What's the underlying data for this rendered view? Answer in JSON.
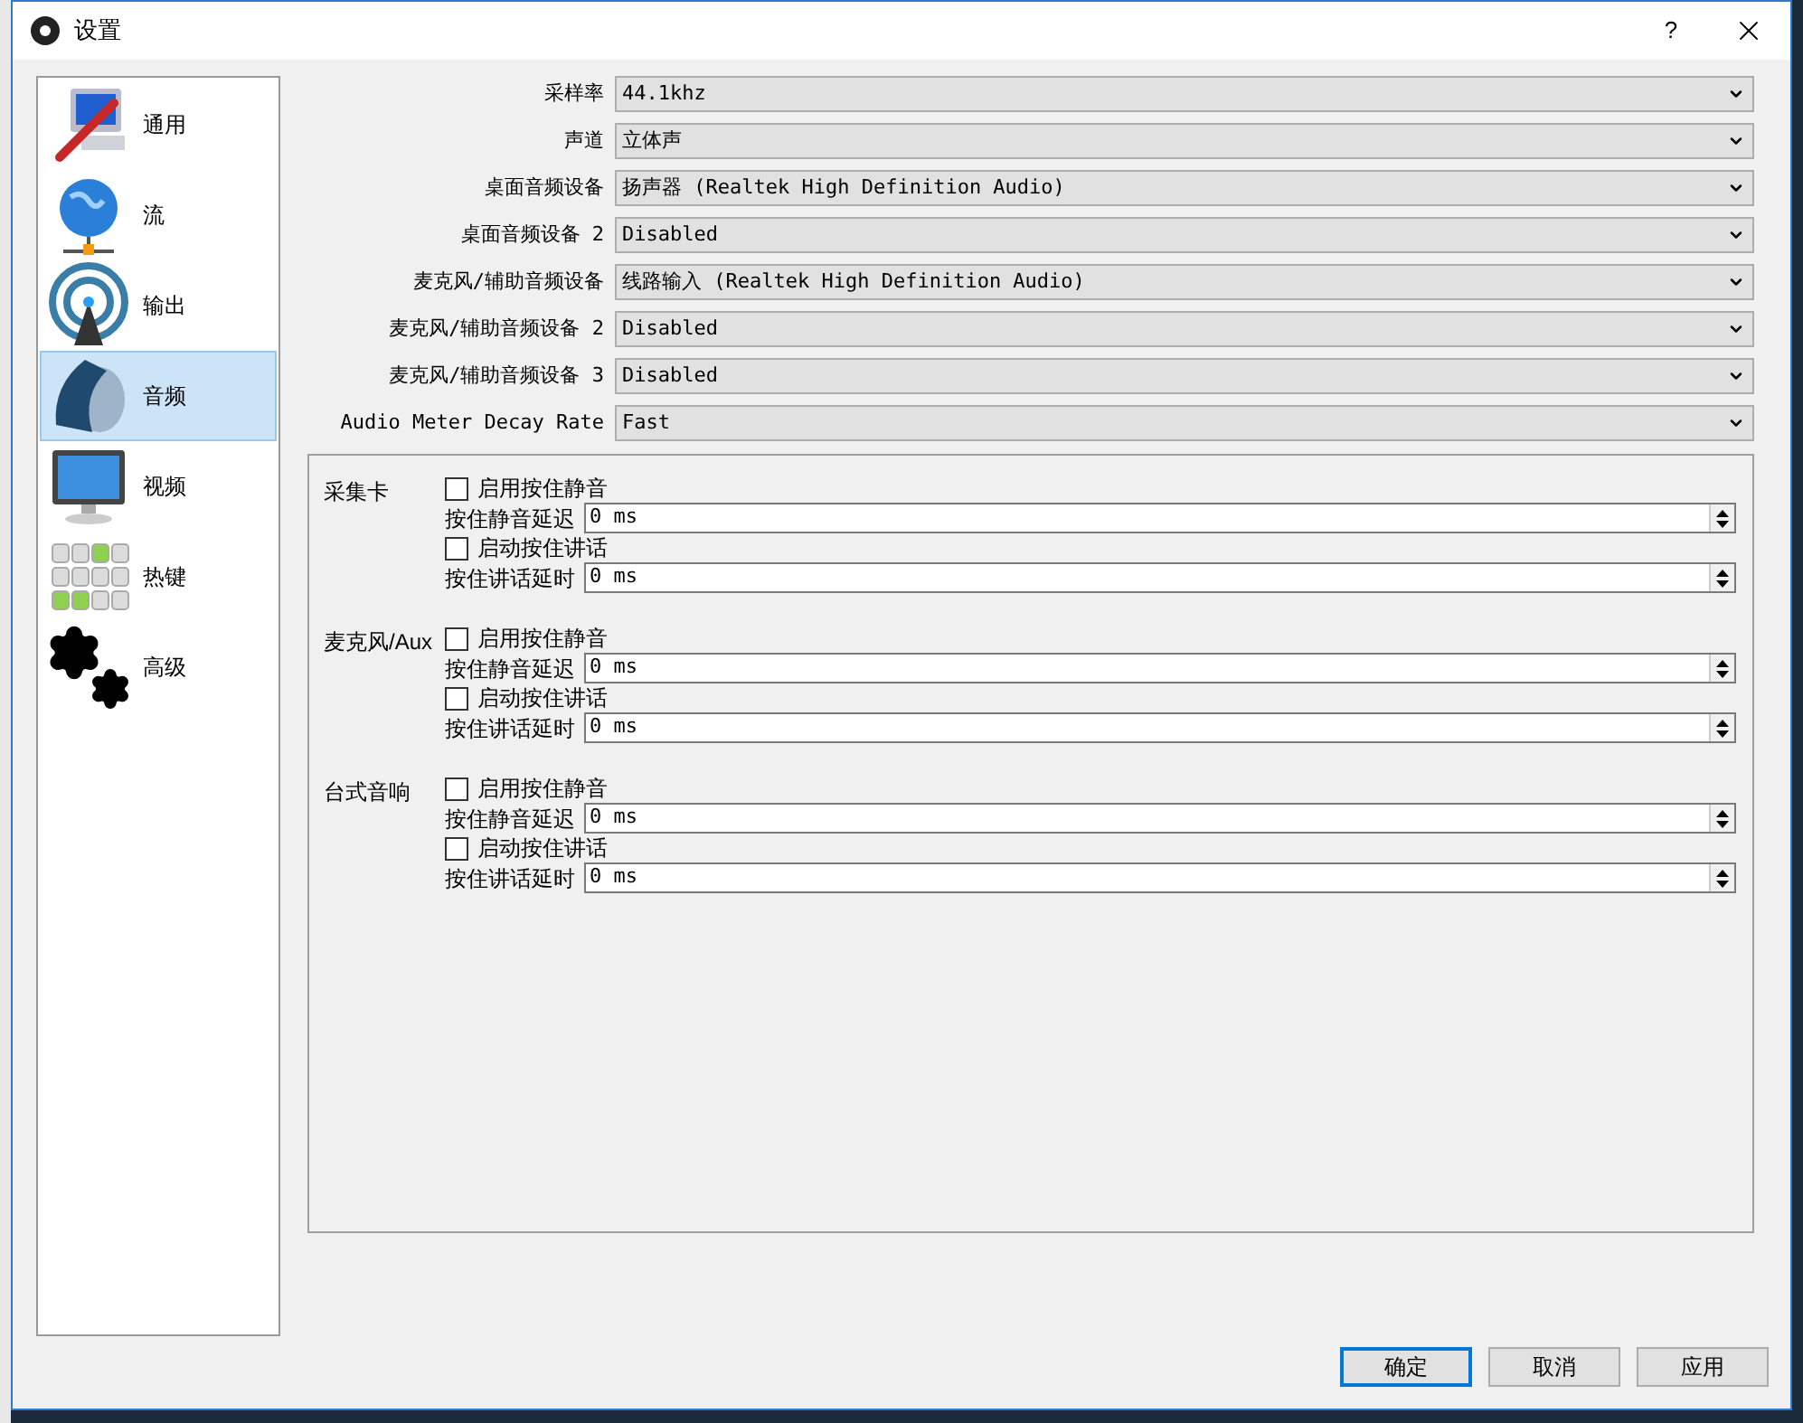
{
  "window": {
    "title": "设置",
    "help": "?"
  },
  "sidebar": {
    "items": [
      {
        "label": "通用",
        "kind": "general",
        "selected": false
      },
      {
        "label": "流",
        "kind": "stream",
        "selected": false
      },
      {
        "label": "输出",
        "kind": "output",
        "selected": false
      },
      {
        "label": "音频",
        "kind": "audio",
        "selected": true
      },
      {
        "label": "视频",
        "kind": "video",
        "selected": false
      },
      {
        "label": "热键",
        "kind": "hotkeys",
        "selected": false
      },
      {
        "label": "高级",
        "kind": "advanced",
        "selected": false
      }
    ]
  },
  "settings": [
    {
      "label": "采样率",
      "value": "44.1khz"
    },
    {
      "label": "声道",
      "value": "立体声"
    },
    {
      "label": "桌面音频设备",
      "value": "扬声器 (Realtek High Definition Audio)"
    },
    {
      "label": "桌面音频设备 2",
      "value": "Disabled"
    },
    {
      "label": "麦克风/辅助音频设备",
      "value": "线路输入 (Realtek High Definition Audio)"
    },
    {
      "label": "麦克风/辅助音频设备 2",
      "value": "Disabled"
    },
    {
      "label": "麦克风/辅助音频设备 3",
      "value": "Disabled"
    },
    {
      "label": "Audio Meter Decay Rate",
      "value": "Fast"
    }
  ],
  "hotkey_groups": [
    {
      "name": "采集卡",
      "rows": [
        {
          "kind": "checkbox",
          "label": "启用按住静音",
          "checked": false
        },
        {
          "kind": "spin",
          "label": "按住静音延迟",
          "value": "0 ms"
        },
        {
          "kind": "checkbox",
          "label": "启动按住讲话",
          "checked": false
        },
        {
          "kind": "spin",
          "label": "按住讲话延时",
          "value": "0 ms"
        }
      ]
    },
    {
      "name": "麦克风/Aux",
      "rows": [
        {
          "kind": "checkbox",
          "label": "启用按住静音",
          "checked": false
        },
        {
          "kind": "spin",
          "label": "按住静音延迟",
          "value": "0 ms"
        },
        {
          "kind": "checkbox",
          "label": "启动按住讲话",
          "checked": false
        },
        {
          "kind": "spin",
          "label": "按住讲话延时",
          "value": "0 ms"
        }
      ]
    },
    {
      "name": "台式音响",
      "rows": [
        {
          "kind": "checkbox",
          "label": "启用按住静音",
          "checked": false
        },
        {
          "kind": "spin",
          "label": "按住静音延迟",
          "value": "0 ms"
        },
        {
          "kind": "checkbox",
          "label": "启动按住讲话",
          "checked": false
        },
        {
          "kind": "spin",
          "label": "按住讲话延时",
          "value": "0 ms"
        }
      ]
    }
  ],
  "buttons": [
    {
      "label": "确定",
      "default": true
    },
    {
      "label": "取消",
      "default": false
    },
    {
      "label": "应用",
      "default": false
    }
  ]
}
